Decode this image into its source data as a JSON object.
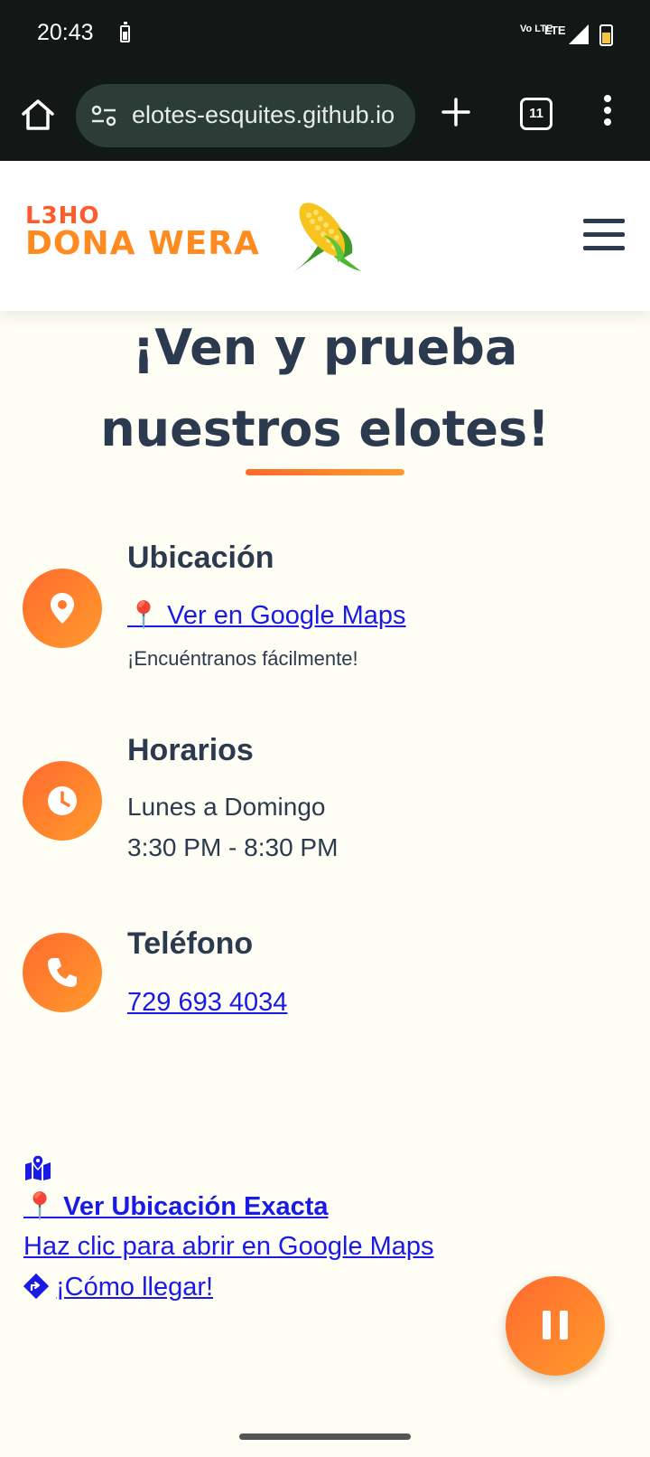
{
  "status_bar": {
    "time": "20:43",
    "volte": "Vo LTE",
    "network": "LTE",
    "icons": [
      "battery-small-icon",
      "signal-icon",
      "battery-icon"
    ]
  },
  "browser": {
    "url": "elotes-esquites.github.io",
    "tab_count": "11",
    "icons": [
      "home-icon",
      "site-info-icon",
      "plus-icon",
      "tabs-icon",
      "more-icon"
    ]
  },
  "header": {
    "logo_line1": "L3HO",
    "logo_line2": "DONA WERA",
    "logo_emoji_name": "corn-icon",
    "menu_icon": "hamburger-icon"
  },
  "hero": {
    "headline": "¡Ven y prueba nuestros elotes!"
  },
  "location": {
    "title": "Ubicación",
    "link": "📍 Ver en Google Maps",
    "note": "¡Encuéntranos fácilmente!",
    "icon": "location-pin-icon"
  },
  "hours": {
    "title": "Horarios",
    "days": "Lunes a Domingo",
    "time": "3:30 PM - 8:30 PM",
    "icon": "clock-icon"
  },
  "phone": {
    "title": "Teléfono",
    "number": "729 693 4034",
    "icon": "phone-icon"
  },
  "map_section": {
    "icon": "map-marked-icon",
    "exact_location": "📍 Ver Ubicación Exacta",
    "open_maps": "Haz clic para abrir en Google Maps",
    "directions": "¡Cómo llegar!",
    "directions_icon": "directions-icon"
  },
  "fab": {
    "icon": "pause-icon"
  },
  "colors": {
    "accent_orange": "#ff7a2c",
    "heading_navy": "#2c3a50",
    "link_blue": "#1a1ae6",
    "page_bg": "#fffef4"
  }
}
